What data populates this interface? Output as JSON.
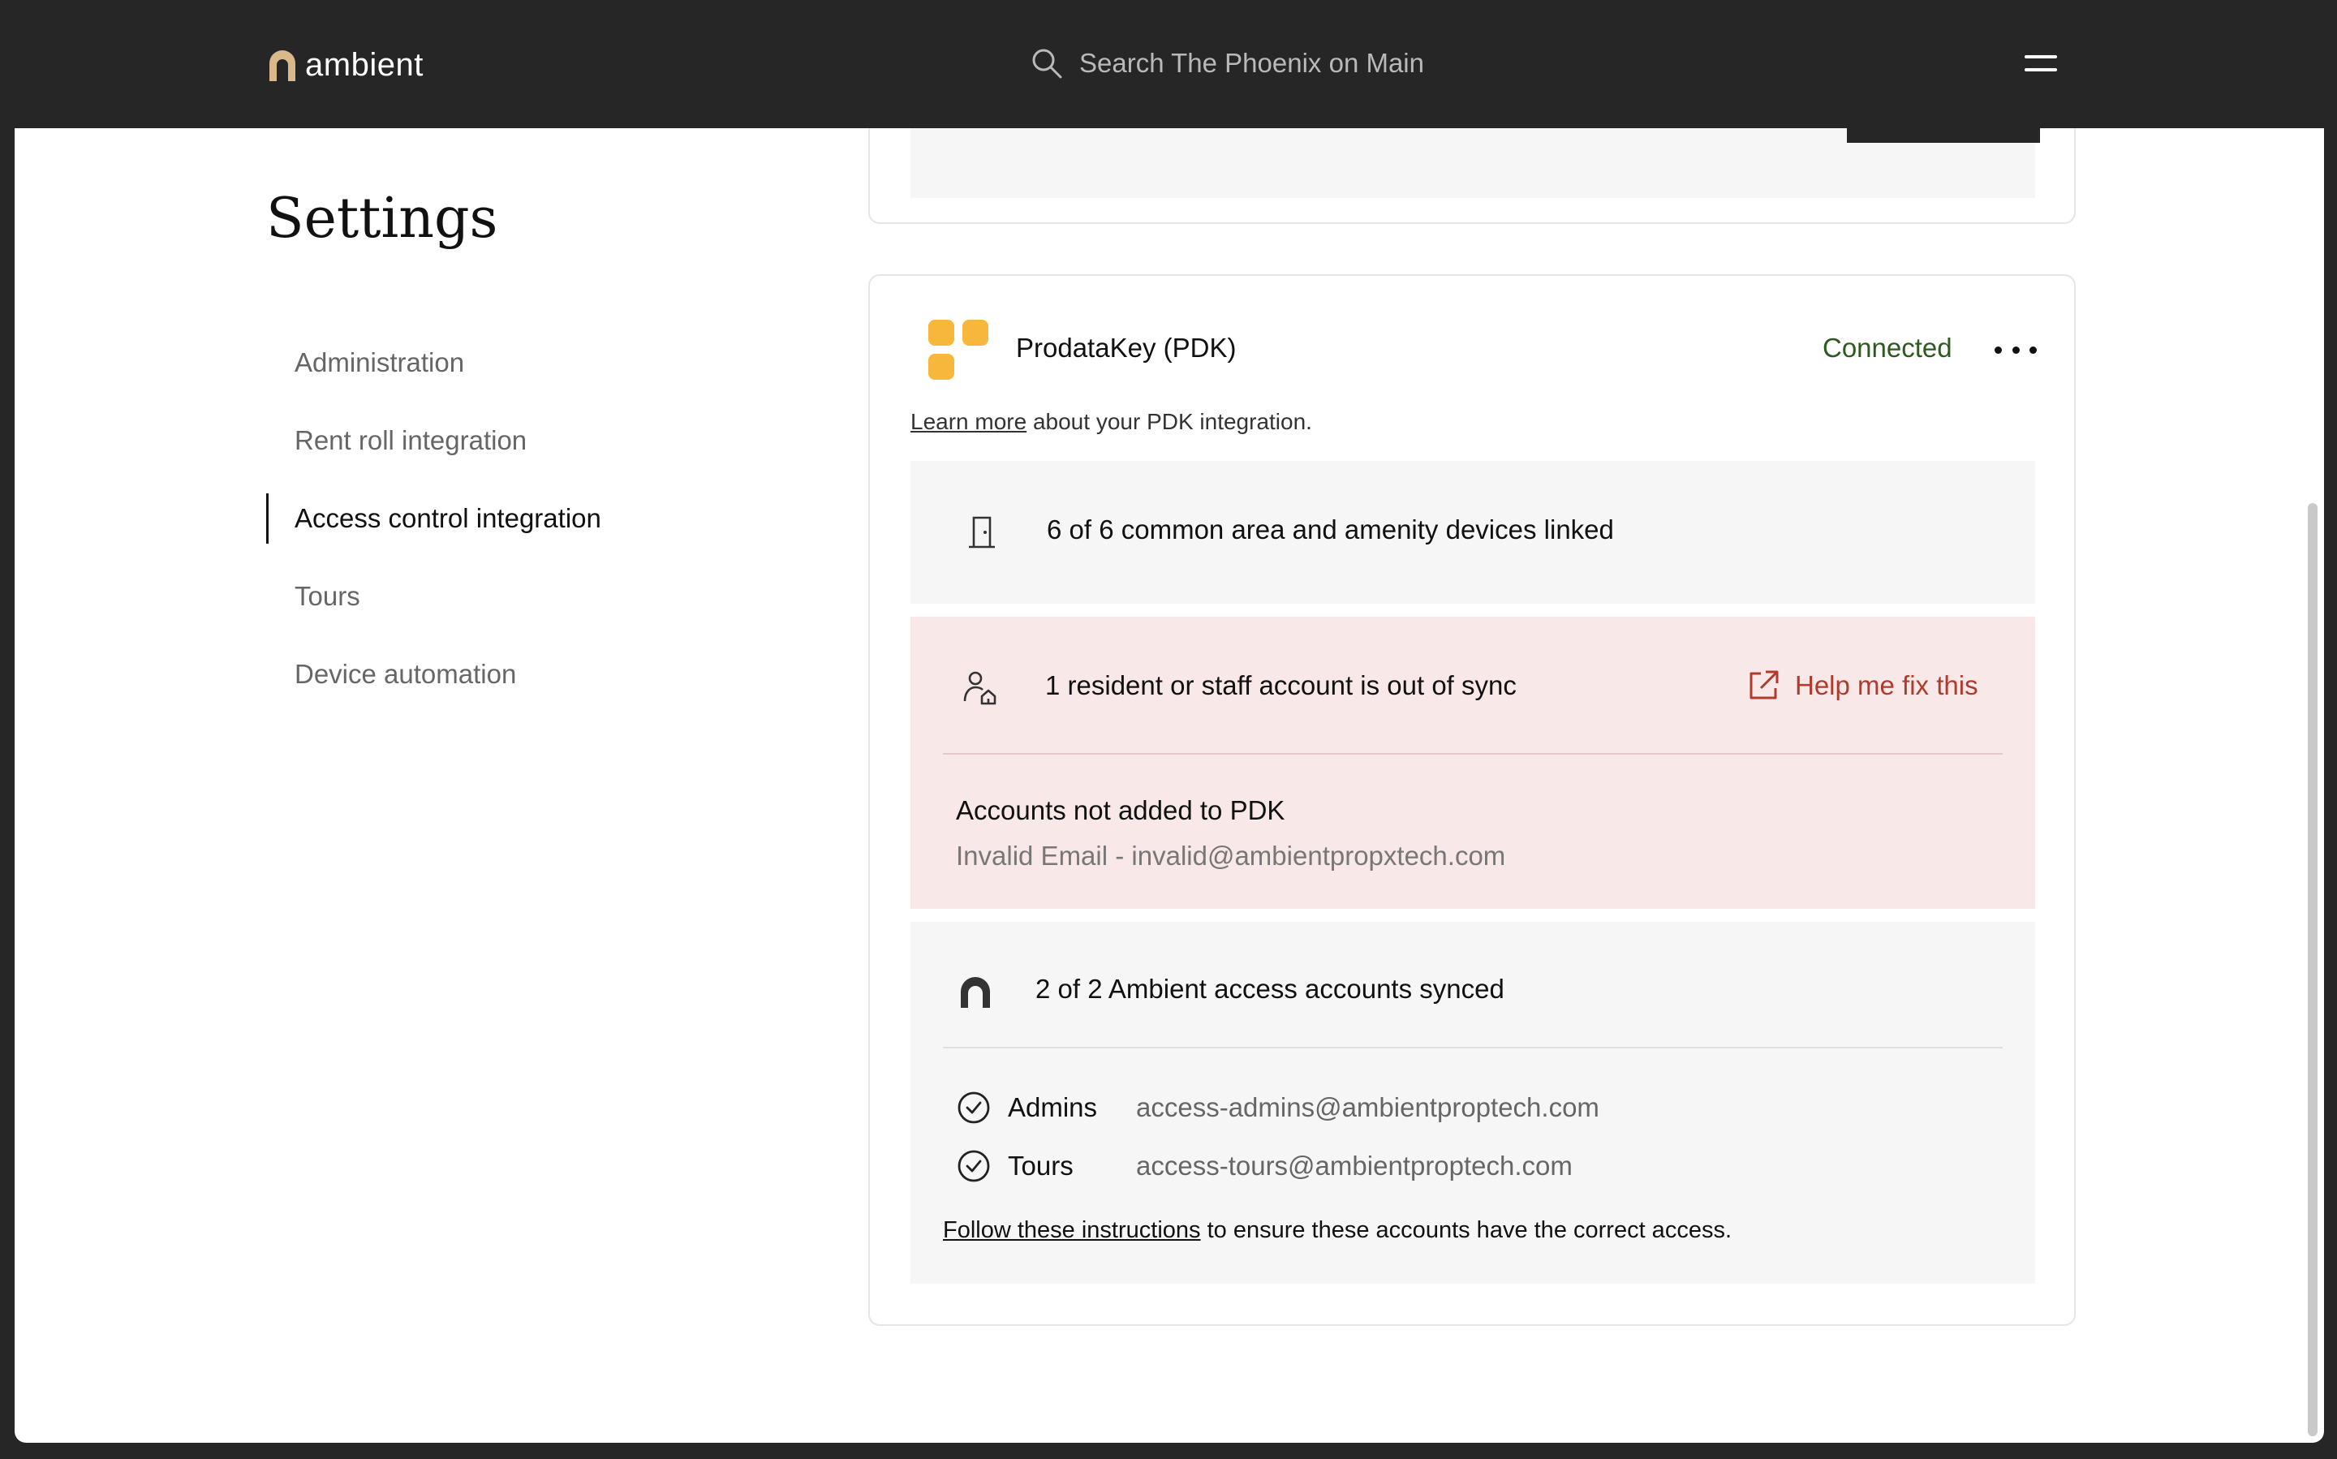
{
  "header": {
    "logo_text": "ambient",
    "search_placeholder": "Search The Phoenix on Main"
  },
  "page": {
    "title": "Settings"
  },
  "sidebar": {
    "items": [
      {
        "label": "Administration",
        "active": false
      },
      {
        "label": "Rent roll integration",
        "active": false
      },
      {
        "label": "Access control integration",
        "active": true
      },
      {
        "label": "Tours",
        "active": false
      },
      {
        "label": "Device automation",
        "active": false
      }
    ]
  },
  "integration": {
    "name": "ProdataKey (PDK)",
    "status": "Connected",
    "learn_link": "Learn more",
    "learn_suffix": " about your PDK integration.",
    "devices": {
      "text": "6 of 6 common area and amenity devices linked",
      "icon": "door-icon"
    },
    "sync": {
      "text": "1 resident or staff account is out of sync",
      "icon": "person-home-icon",
      "help_label": "Help me fix this",
      "help_icon": "external-link-icon",
      "section_title": "Accounts not added to PDK",
      "error_line": "Invalid Email - invalid@ambientpropxtech.com"
    },
    "ambient": {
      "text": "2 of 2 Ambient access accounts synced",
      "icon": "ambient-arch-icon",
      "accounts": [
        {
          "name": "Admins",
          "email": "access-admins@ambientproptech.com"
        },
        {
          "name": "Tours",
          "email": "access-tours@ambientproptech.com"
        }
      ],
      "follow_link": "Follow these instructions",
      "follow_suffix": " to ensure these accounts have the correct access."
    }
  },
  "colors": {
    "topbar": "#262626",
    "connected": "#2d5a1f",
    "error_bg": "#f9e8e8",
    "error_text": "#b23a2c",
    "pdk_brand": "#f6b73c",
    "ambient_logo": "#d9b88a"
  }
}
